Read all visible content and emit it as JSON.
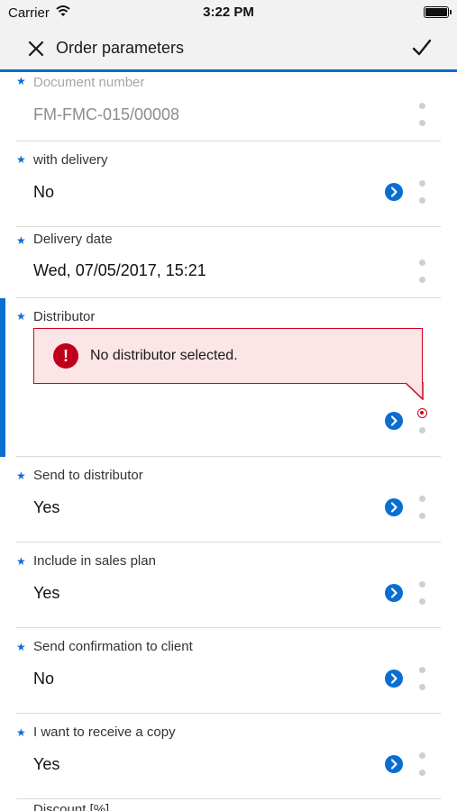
{
  "status_bar": {
    "carrier": "Carrier",
    "time": "3:22 PM"
  },
  "nav": {
    "title": "Order parameters"
  },
  "fields": [
    {
      "label": "Document number",
      "value": "FM-FMC-015/00008",
      "required": true,
      "readonly": true
    },
    {
      "label": "with delivery",
      "value": "No",
      "required": true
    },
    {
      "label": "Delivery date",
      "value": "Wed, 07/05/2017, 15:21",
      "required": true
    },
    {
      "label": "Distributor",
      "value": "",
      "required": true,
      "error": "No distributor selected."
    },
    {
      "label": "Send to distributor",
      "value": "Yes",
      "required": true
    },
    {
      "label": "Include in sales plan",
      "value": "Yes",
      "required": true
    },
    {
      "label": "Send confirmation to client",
      "value": "No",
      "required": true
    },
    {
      "label": "I want to receive a copy",
      "value": "Yes",
      "required": true
    },
    {
      "label": "Discount [%]",
      "value": "",
      "required": false
    }
  ],
  "colors": {
    "accent": "#0a6ed1",
    "error": "#d0021b",
    "error_bg": "#fbe5e6",
    "bar_bg": "#f2f2f2"
  },
  "icons": {
    "close": "close-icon",
    "confirm": "checkmark-icon",
    "select": "chevron-right-icon",
    "more": "more-dots-icon",
    "error": "exclamation-icon"
  }
}
